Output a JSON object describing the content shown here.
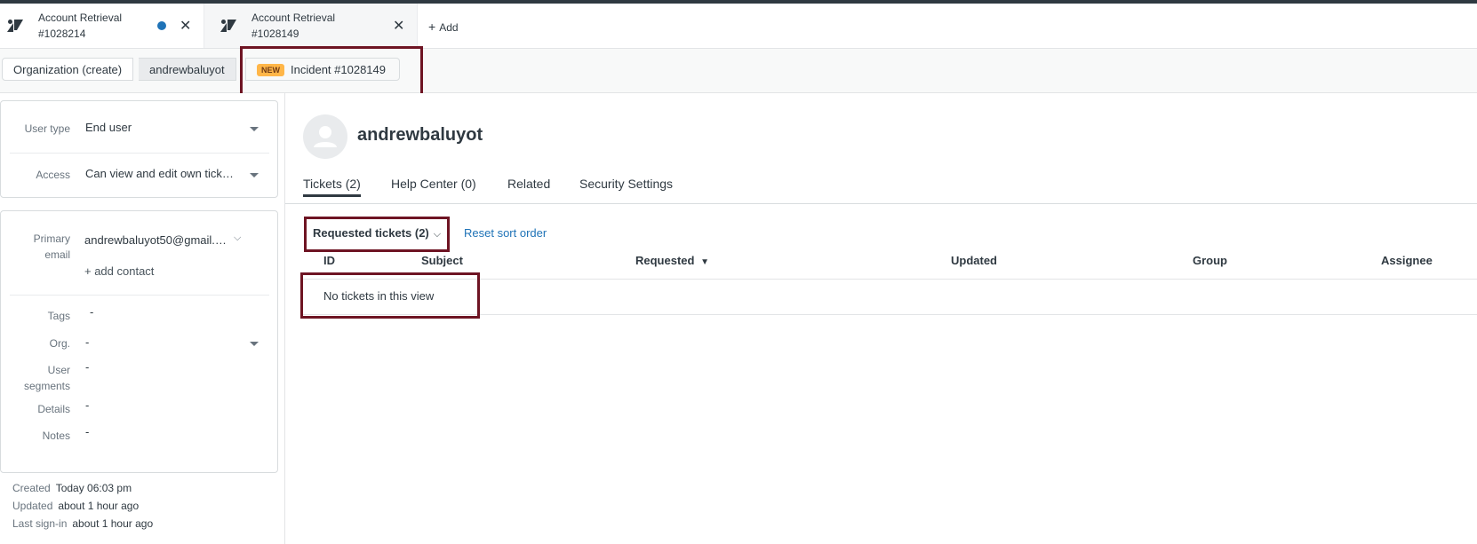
{
  "tabs": [
    {
      "title": "Account Retrieval",
      "subtitle": "#1028214",
      "has_unread": true
    },
    {
      "title": "Account Retrieval",
      "subtitle": "#1028149",
      "has_unread": false
    }
  ],
  "add_tab_label": "Add",
  "breadcrumbs": {
    "org": "Organization (create)",
    "user": "andrewbaluyot",
    "ticket_badge": "NEW",
    "ticket": "Incident #1028149"
  },
  "user_fields": {
    "user_type_label": "User type",
    "user_type_value": "End user",
    "access_label": "Access",
    "access_value": "Can view and edit own tick…"
  },
  "contact": {
    "primary_email_label_1": "Primary",
    "primary_email_label_2": "email",
    "primary_email_value": "andrewbaluyot50@gmail.…",
    "add_contact": "+ add contact",
    "tags_label": "Tags",
    "tags_value": "-",
    "org_label": "Org.",
    "org_value": "-",
    "segments_label_1": "User",
    "segments_label_2": "segments",
    "segments_value": "-",
    "details_label": "Details",
    "details_value": "-",
    "notes_label": "Notes",
    "notes_value": "-"
  },
  "meta": {
    "created_label": "Created",
    "created_value": "Today 06:03 pm",
    "updated_label": "Updated",
    "updated_value": "about 1 hour ago",
    "signin_label": "Last sign-in",
    "signin_value": "about 1 hour ago"
  },
  "profile": {
    "name": "andrewbaluyot",
    "tabs": [
      "Tickets (2)",
      "Help Center (0)",
      "Related",
      "Security Settings"
    ],
    "active_tab": 0
  },
  "tickets_view": {
    "selector": "Requested tickets (2)",
    "reset_sort": "Reset sort order",
    "columns": [
      "ID",
      "Subject",
      "Requested",
      "Updated",
      "Group",
      "Assignee"
    ],
    "sorted_indicator": "▼",
    "empty_message": "No tickets in this view"
  },
  "colors": {
    "accent_blue": "#1f73b7",
    "highlight": "#6e1423",
    "new_badge": "#ffb648"
  }
}
